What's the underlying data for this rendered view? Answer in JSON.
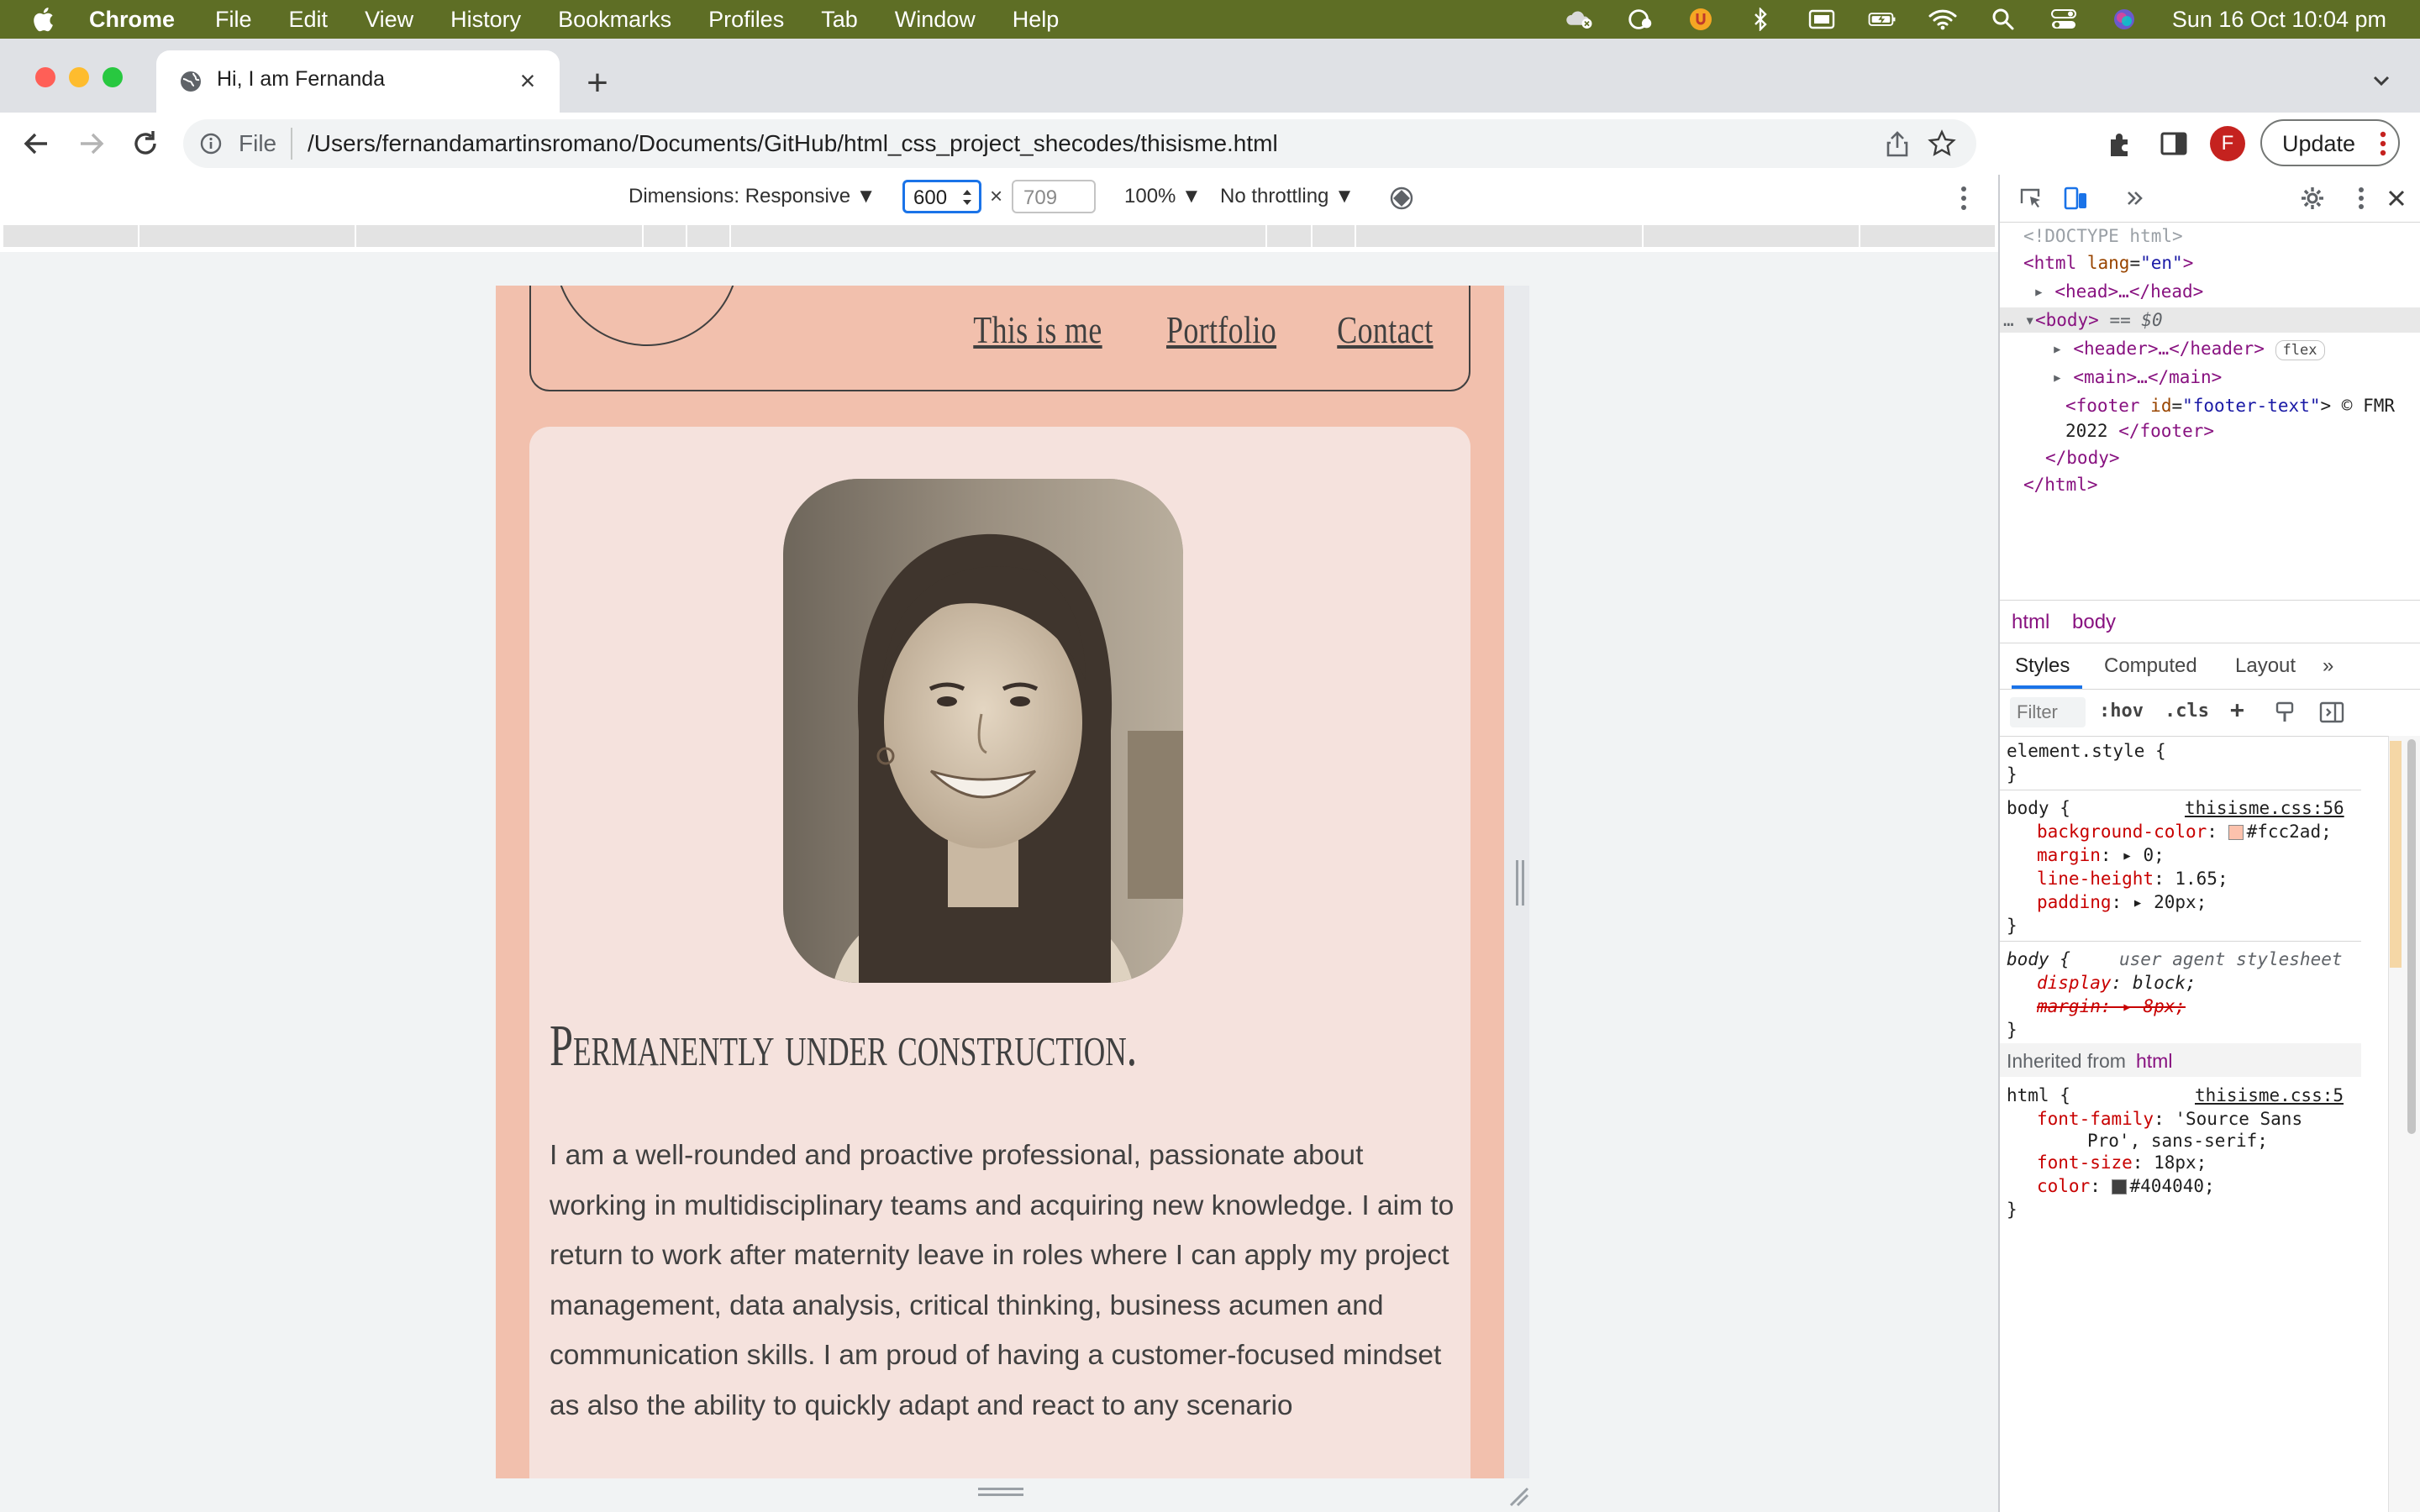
{
  "menubar": {
    "app_name": "Chrome",
    "items": [
      "File",
      "Edit",
      "View",
      "History",
      "Bookmarks",
      "Profiles",
      "Tab",
      "Window",
      "Help"
    ],
    "clock": "Sun 16 Oct  10:04 pm"
  },
  "tab": {
    "title": "Hi, I am Fernanda"
  },
  "omnibox": {
    "scheme": "File",
    "url": "/Users/fernandamartinsromano/Documents/GitHub/html_css_project_shecodes/thisisme.html"
  },
  "profile": {
    "initial": "F"
  },
  "update_button": {
    "label": "Update"
  },
  "device_toolbar": {
    "dimensions": "Dimensions: Responsive ▼",
    "width": "600",
    "times": "×",
    "height": "709",
    "zoom": "100% ▼",
    "throttling": "No throttling ▼"
  },
  "site": {
    "nav": [
      "This is me",
      "Portfolio",
      "Contact"
    ],
    "title": "Permanently under construction.",
    "bio": "I am a well-rounded and proactive professional, passionate about working in multidisciplinary teams and acquiring new knowledge. I aim to return to work after maternity leave in roles where I can apply my project management, data analysis, critical thinking, business acumen and communication skills. I am proud of having a customer-focused mindset as also the ability to quickly adapt and react to any scenario"
  },
  "devtools": {
    "dom": {
      "doctype": "<!DOCTYPE html>",
      "html_open_tag": "<html",
      "html_lang_attr": "lang",
      "html_lang_val": "\"en\"",
      "html_open_end": ">",
      "head": "<head>…</head>",
      "body_tag": "<body>",
      "body_eq": " == $0",
      "header": "<header>…</header>",
      "header_badge": "flex",
      "main": "<main>…</main>",
      "footer_open": "<footer",
      "footer_attr": "id",
      "footer_val": "\"footer-text\"",
      "footer_text": "> © FMR",
      "footer_text2": "2022 ",
      "footer_close": "</footer>",
      "body_close": "</body>",
      "html_close": "</html>"
    },
    "crumbs": [
      "html",
      "body"
    ],
    "subtabs": [
      "Styles",
      "Computed",
      "Layout"
    ],
    "filter_placeholder": "Filter",
    "hov": ":hov",
    "cls": ".cls",
    "styles": {
      "element_style": "element.style {",
      "close": "}",
      "body_selector": "body {",
      "body_source": "thisisme.css:56",
      "bg_prop": "background-color",
      "bg_val": "#fcc2ad;",
      "margin_prop": "margin",
      "margin_val": "0;",
      "lh_prop": "line-height",
      "lh_val": "1.65;",
      "padding_prop": "padding",
      "padding_val": "20px;",
      "ua_selector": "body {",
      "ua_label": "user agent stylesheet",
      "display_prop": "display",
      "display_val": "block;",
      "ua_margin": "margin: ▸ 8px;",
      "inherited_label": "Inherited from",
      "inherited_tag": "html",
      "html_selector": "html {",
      "html_source": "thisisme.css:5",
      "ff_prop": "font-family",
      "ff_val": "'Source Sans",
      "ff_val2": "Pro', sans-serif;",
      "fs_prop": "font-size",
      "fs_val": "18px;",
      "color_prop": "color",
      "color_val": "#404040;"
    }
  },
  "colors": {
    "menubar": "#5e6e25",
    "page_bg": "#fcc2ad",
    "card_bg": "#f5e2dd",
    "text": "#404040",
    "accent": "#1a73e8"
  }
}
